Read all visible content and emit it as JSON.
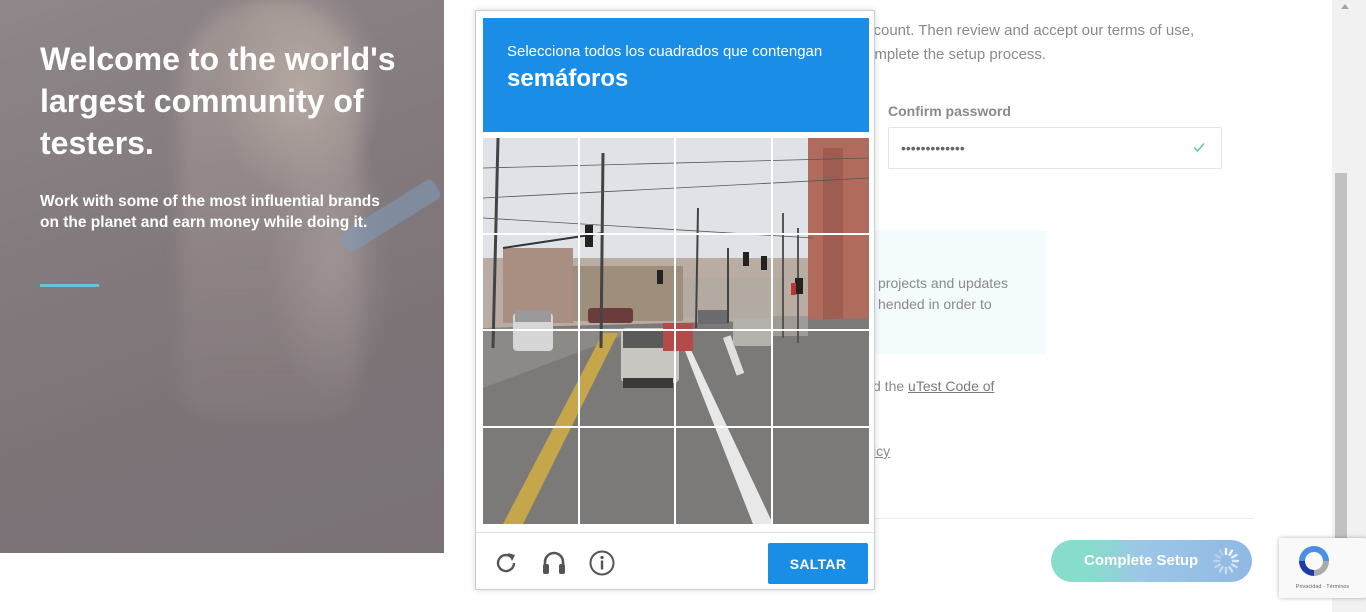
{
  "hero": {
    "title": "Welcome to the world's largest community of testers.",
    "subtitle": "Work with some of the most influential brands on the planet and earn money while doing it."
  },
  "form": {
    "intro_line1": "ccount. Then review and accept our terms of use,",
    "intro_line2": "omplete the setup process.",
    "confirm_password_label": "Confirm password",
    "confirm_password_value": "•••••••••••••",
    "notice_line1": "projects and updates",
    "notice_line2": "hended in order to",
    "code_prefix": "d the ",
    "code_link": "uTest Code of",
    "policy_text": "icy",
    "complete_button": "Complete Setup"
  },
  "captcha": {
    "instruction": "Selecciona todos los cuadrados que contengan",
    "target": "semáforos",
    "skip_button": "SALTAR",
    "icons": [
      "reload-icon",
      "audio-icon",
      "info-icon"
    ]
  },
  "recaptcha_badge": {
    "links": "Privacidad - Términos"
  },
  "colors": {
    "captcha_blue": "#1a8ee6",
    "accent_line": "#66c2d6",
    "complete_green": "#88dccb",
    "check_green": "#5fc9a8"
  }
}
